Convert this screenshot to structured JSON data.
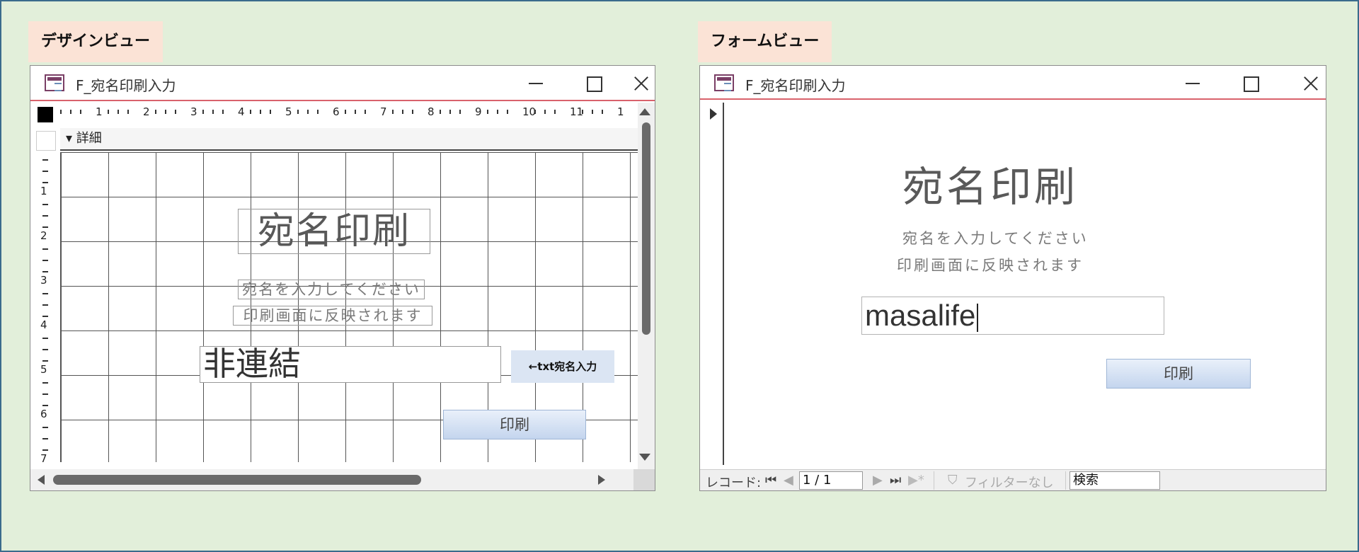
{
  "design_panel": {
    "label": "デザインビュー",
    "window": {
      "title": "F_宛名印刷入力",
      "section_label": "詳細",
      "ruler_h": [
        "1",
        "2",
        "3",
        "4",
        "5",
        "6",
        "7",
        "8",
        "9",
        "10",
        "11",
        "1"
      ],
      "ruler_v": [
        "1",
        "2",
        "3",
        "4",
        "5",
        "6",
        "7"
      ],
      "title_label": "宛名印刷",
      "sub_label_1": "宛名を入力してください",
      "sub_label_2": "印刷画面に反映されます",
      "textbox_value": "非連結",
      "textbox_note": "←txt宛名入力",
      "print_button": "印刷"
    }
  },
  "form_panel": {
    "label": "フォームビュー",
    "window": {
      "title": "F_宛名印刷入力",
      "title_label": "宛名印刷",
      "sub_label_1": "宛名を入力してください",
      "sub_label_2": "印刷画面に反映されます",
      "input_value": "masalife",
      "print_button": "印刷",
      "nav": {
        "record_label": "レコード:",
        "first": "⏮",
        "prev": "◀",
        "position": "1 / 1",
        "next": "▶",
        "last": "⏭",
        "new": "▶*",
        "filter_icon": "⛉",
        "filter_text": "フィルターなし",
        "search_placeholder": "検索"
      }
    }
  },
  "colors": {
    "background": "#e2efda",
    "label_bg": "#fbe3d6",
    "titlebar_accent": "#d9626c",
    "button_gradient_top": "#e9f0fa",
    "button_gradient_bottom": "#c4d5ee",
    "note_bg": "#dbe5f3"
  },
  "icons": {
    "app": "access-form-icon",
    "minimize": "minimize-icon",
    "maximize": "maximize-icon",
    "close": "close-icon"
  }
}
